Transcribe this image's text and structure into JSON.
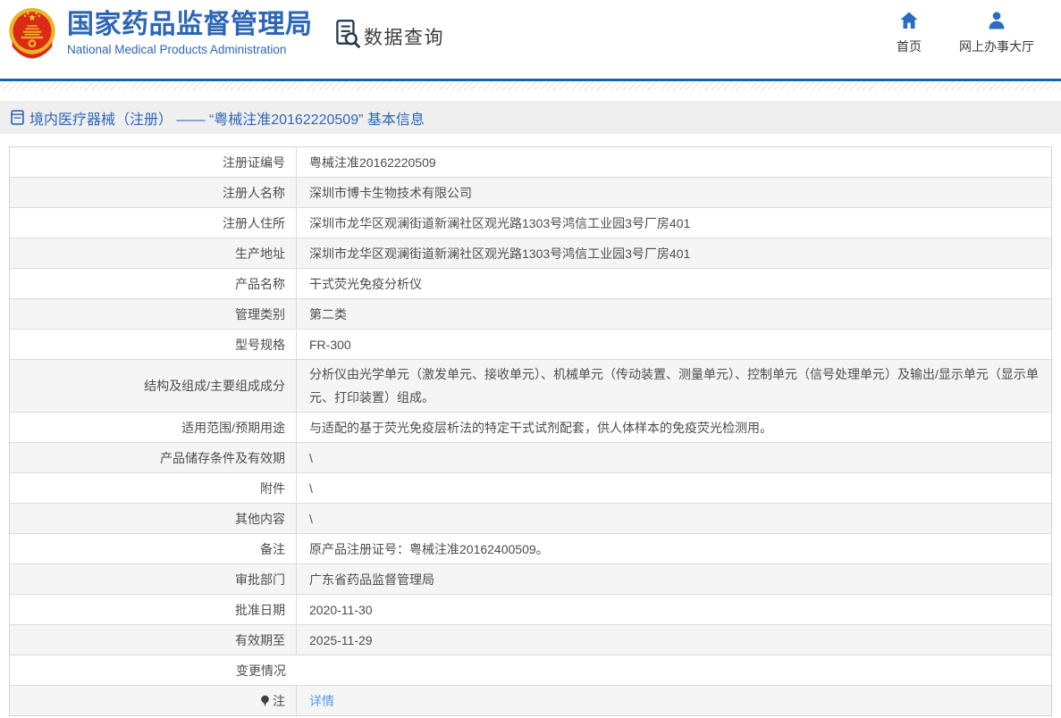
{
  "colors": {
    "brand_blue": "#2d66b5",
    "nav_icon_blue": "#2a6cc0",
    "divider_blue": "#1565b0",
    "link_blue": "#569ae6",
    "row_alt_bg": "#f5f5f6",
    "table_border": "#dcdcdc",
    "text_dark": "#4d4d4d",
    "emblem_red": "#dc2b14",
    "emblem_gold": "#e8b42a",
    "query_icon_dark": "#2a3b4f"
  },
  "header": {
    "site_title": "国家药品监督管理局",
    "site_subtitle": "National Medical Products Administration",
    "section_label": "数据查询",
    "nav": [
      {
        "label": "首页",
        "icon": "home-icon"
      },
      {
        "label": "网上办事大厅",
        "icon": "user-icon"
      }
    ]
  },
  "breadcrumb": {
    "label": "境内医疗器械（注册） —— “粤械注准20162220509” 基本信息"
  },
  "table": {
    "rows": [
      {
        "label": "注册证编号",
        "value": "粤械注准20162220509"
      },
      {
        "label": "注册人名称",
        "value": "深圳市博卡生物技术有限公司"
      },
      {
        "label": "注册人住所",
        "value": "深圳市龙华区观澜街道新澜社区观光路1303号鸿信工业园3号厂房401"
      },
      {
        "label": "生产地址",
        "value": "深圳市龙华区观澜街道新澜社区观光路1303号鸿信工业园3号厂房401"
      },
      {
        "label": "产品名称",
        "value": "干式荧光免疫分析仪"
      },
      {
        "label": "管理类别",
        "value": "第二类"
      },
      {
        "label": "型号规格",
        "value": "FR-300"
      },
      {
        "label": "结构及组成/主要组成成分",
        "value": "分析仪由光学单元（激发单元、接收单元）、机械单元（传动装置、测量单元）、控制单元（信号处理单元）及输出/显示单元（显示单元、打印装置）组成。"
      },
      {
        "label": "适用范围/预期用途",
        "value": "与适配的基于荧光免疫层析法的特定干式试剂配套，供人体样本的免疫荧光检测用。"
      },
      {
        "label": "产品储存条件及有效期",
        "value": "\\"
      },
      {
        "label": "附件",
        "value": "\\"
      },
      {
        "label": "其他内容",
        "value": "\\"
      },
      {
        "label": "备注",
        "value": "原产品注册证号：粤械注准20162400509。"
      },
      {
        "label": "审批部门",
        "value": "广东省药品监督管理局"
      },
      {
        "label": "批准日期",
        "value": "2020-11-30"
      },
      {
        "label": "有效期至",
        "value": "2025-11-29"
      },
      {
        "label": "变更情况",
        "value": ""
      },
      {
        "label": "注",
        "value": "详情"
      }
    ]
  }
}
